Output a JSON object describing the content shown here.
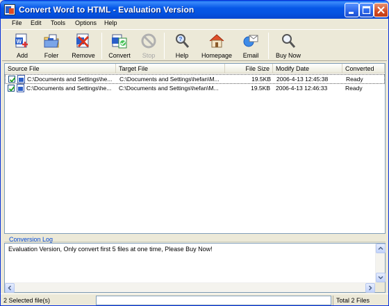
{
  "window": {
    "title": "Convert Word to HTML  -  Evaluation Version"
  },
  "menu": [
    "File",
    "Edit",
    "Tools",
    "Options",
    "Help"
  ],
  "toolbar": {
    "add": "Add",
    "folder": "Foler",
    "remove": "Remove",
    "convert": "Convert",
    "stop": "Stop",
    "help": "Help",
    "homepage": "Homepage",
    "email": "Email",
    "buy_now": "Buy Now"
  },
  "file_list": {
    "columns": [
      "Source File",
      "Target File",
      "File Size",
      "Modify Date",
      "Converted"
    ],
    "rows": [
      {
        "checked": true,
        "source": "C:\\Documents and Settings\\he...",
        "target": "C:\\Documents and Settings\\hefan\\M...",
        "size": "19.5KB",
        "date": "2006-4-13 12:45:38",
        "status": "Ready"
      },
      {
        "checked": true,
        "source": "C:\\Documents and Settings\\he...",
        "target": "C:\\Documents and Settings\\hefan\\M...",
        "size": "19.5KB",
        "date": "2006-4-13 12:46:33",
        "status": "Ready"
      }
    ]
  },
  "log": {
    "label": "Conversion Log",
    "text": "Evaluation Version, Only convert first 5 files at one time, Please Buy Now!"
  },
  "status": {
    "selected": "2 Selected file(s)",
    "total": "Total 2 Files"
  },
  "colors": {
    "titlebar": "#0553e1",
    "log_label": "#0046d5",
    "window_bg": "#ece9d8"
  }
}
